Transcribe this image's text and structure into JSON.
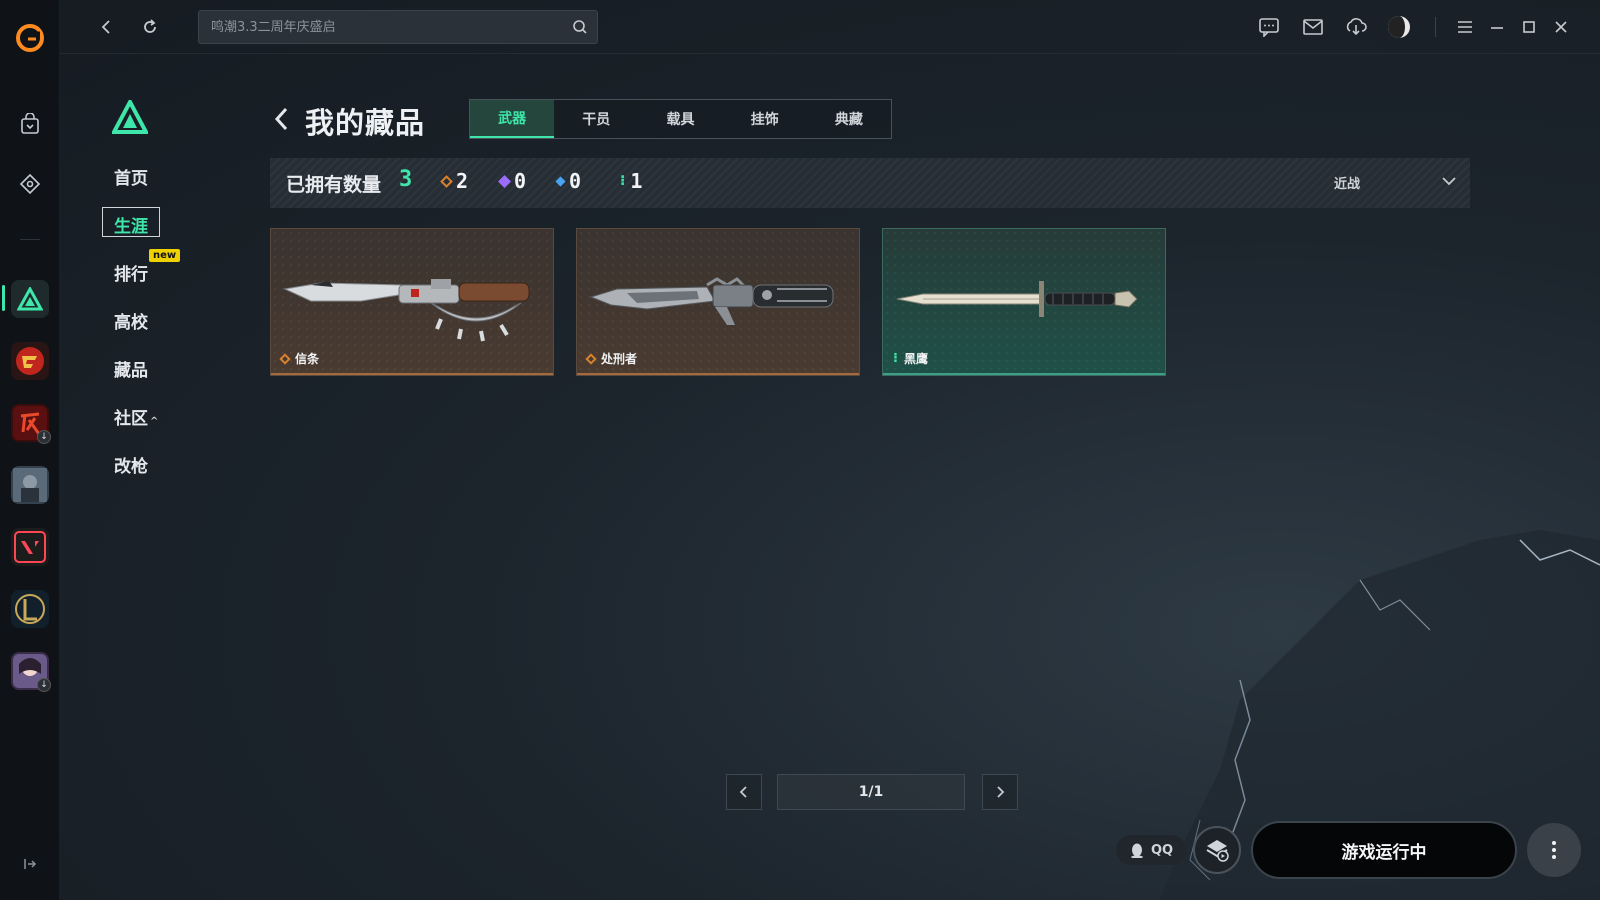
{
  "app": {
    "search_placeholder": "鸣潮3.3二周年庆盛启",
    "accent": "#3ee6a9"
  },
  "nav": {
    "items": [
      {
        "label": "首页"
      },
      {
        "label": "生涯"
      },
      {
        "label": "排行"
      },
      {
        "label": "高校"
      },
      {
        "label": "藏品"
      },
      {
        "label": "社区"
      },
      {
        "label": "改枪"
      }
    ],
    "active_index": 1,
    "new_badge": "new"
  },
  "page": {
    "title": "我的藏品",
    "tabs": [
      {
        "label": "武器"
      },
      {
        "label": "干员"
      },
      {
        "label": "载具"
      },
      {
        "label": "挂饰"
      },
      {
        "label": "典藏"
      }
    ],
    "active_tab": 0
  },
  "stats": {
    "label": "已拥有数量",
    "total": "3",
    "tiers": [
      {
        "count": "2",
        "color": "#d9822b"
      },
      {
        "count": "0",
        "color": "#9b6cff"
      },
      {
        "count": "0",
        "color": "#4aa3f0"
      },
      {
        "count": "1",
        "color": "#3ee6a9"
      }
    ],
    "filter": "近战"
  },
  "cards": [
    {
      "name": "信条",
      "rarity_color": "#d9822b",
      "theme": "orange"
    },
    {
      "name": "处刑者",
      "rarity_color": "#d9822b",
      "theme": "orange"
    },
    {
      "name": "黑鹰",
      "rarity_color": "#3ee6a9",
      "theme": "green"
    }
  ],
  "pagination": {
    "text": "1/1"
  },
  "footer": {
    "qq_label": "QQ",
    "launch_label": "游戏运行中"
  }
}
